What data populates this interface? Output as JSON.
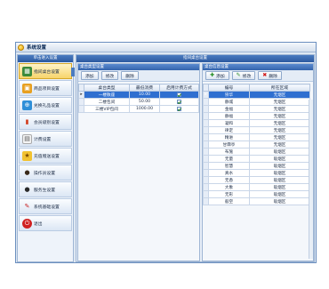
{
  "window": {
    "title": "系统设置"
  },
  "sidebar": {
    "header": "单击进入设置",
    "items": [
      {
        "label": "指间桌台设置",
        "icon": "table-icon",
        "active": true
      },
      {
        "label": "商品项目设置",
        "icon": "goods-icon"
      },
      {
        "label": "兑换礼品设置",
        "icon": "gift-icon"
      },
      {
        "label": "会员级别设置",
        "icon": "member-level-icon"
      },
      {
        "label": "计费设置",
        "icon": "billing-icon"
      },
      {
        "label": "充值赠送设置",
        "icon": "recharge-icon"
      },
      {
        "label": "操作员设置",
        "icon": "operator-icon"
      },
      {
        "label": "服务生设置",
        "icon": "waiter-icon"
      },
      {
        "label": "系统基础设置",
        "icon": "settings-icon"
      },
      {
        "label": "退出",
        "icon": "exit-icon"
      }
    ]
  },
  "main": {
    "header": "指间桌台设置"
  },
  "left_panel": {
    "title": "桌台类型设置",
    "buttons": {
      "add": "添加",
      "edit": "修改",
      "delete": "删除"
    },
    "columns": [
      "桌台类型",
      "最低消费",
      "启用计费方式"
    ],
    "rows": [
      {
        "type": "一楼散座",
        "min": "10.00",
        "billing": true
      },
      {
        "type": "二楼包间",
        "min": "50.00",
        "billing": true
      },
      {
        "type": "三楼VIP包间",
        "min": "1000.00",
        "billing": true
      }
    ]
  },
  "right_panel": {
    "title": "桌台信息设置",
    "buttons": {
      "add": "添加",
      "edit": "修改",
      "delete": "删除"
    },
    "columns": [
      "编号",
      "所在区域"
    ],
    "rows": [
      {
        "id": "崇华",
        "area": "无烟区"
      },
      {
        "id": "静城",
        "area": "无烟区"
      },
      {
        "id": "金福",
        "area": "无烟区"
      },
      {
        "id": "静福",
        "area": "无烟区"
      },
      {
        "id": "凝和",
        "area": "无烟区"
      },
      {
        "id": "律定",
        "area": "无烟区"
      },
      {
        "id": "精进",
        "area": "无烟区"
      },
      {
        "id": "甘霖亭",
        "area": "无烟区"
      },
      {
        "id": "布施",
        "area": "吸烟区"
      },
      {
        "id": "无量",
        "area": "吸烟区"
      },
      {
        "id": "智慧",
        "area": "吸烟区"
      },
      {
        "id": "真水",
        "area": "吸烟区"
      },
      {
        "id": "无香",
        "area": "吸烟区"
      },
      {
        "id": "大象",
        "area": "吸烟区"
      },
      {
        "id": "无形",
        "area": "吸烟区"
      },
      {
        "id": "般空",
        "area": "吸烟区"
      }
    ]
  }
}
